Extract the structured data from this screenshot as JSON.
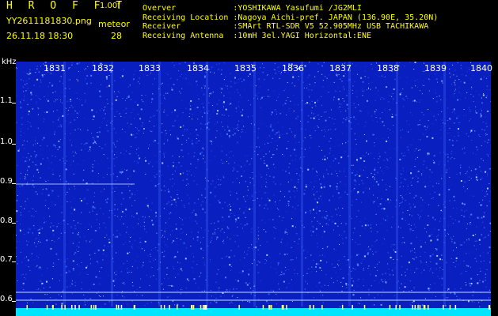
{
  "header": {
    "title": "H R O F F T",
    "version": "1.00f",
    "filename": "YY2611181830.png",
    "meteor_label": "meteor",
    "datetime": "26.11.18 18:30",
    "meteor_count": "28",
    "info_rows": [
      "Overver            :YOSHIKAWA Yasufumi /JG2MLI",
      "Receiving Location :Nagoya Aichi-pref. JAPAN (136.90E, 35.20N)",
      "Receiver           :SMArt RTL-SDR V5 52.905MHz USB TACHIKAWA",
      "Receiving Antenna  :10mH 3el.YAGI Horizontal:ENE"
    ]
  },
  "axis": {
    "unit": "kHz",
    "y_ticks": [
      "1.1",
      "1.0",
      "0.9",
      "0.8",
      "0.7",
      "0.6"
    ],
    "x_ticks": [
      "1831",
      "1832",
      "1833",
      "1834",
      "1835",
      "1836",
      "1837",
      "1838",
      "1839",
      "1840"
    ]
  },
  "colors": {
    "background": "#000000",
    "spectrum_base": "#0a1fbf",
    "noise": "#4a7bff",
    "floor": "#00e5ff",
    "label": "#ffff00"
  }
}
